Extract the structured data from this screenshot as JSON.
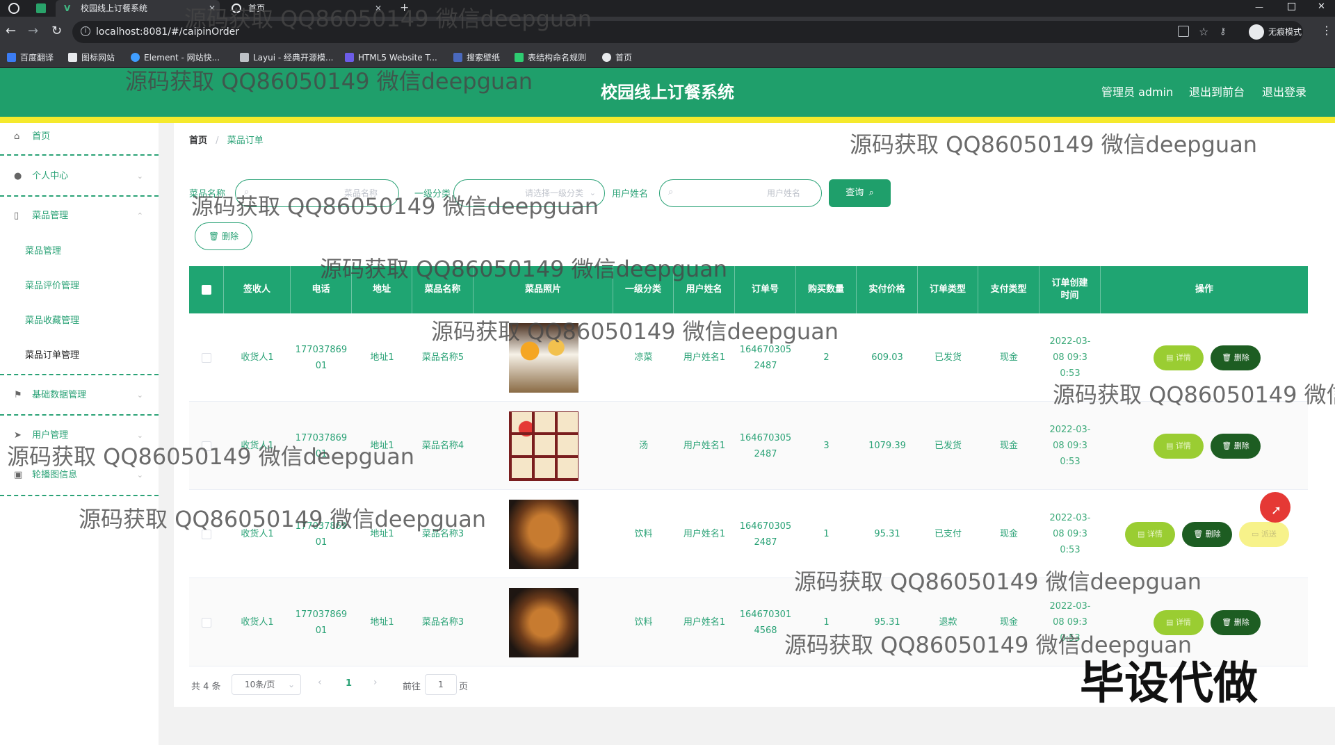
{
  "browser": {
    "tabs": [
      {
        "title": "校园线上订餐系统"
      },
      {
        "title": "首页"
      }
    ],
    "url": "localhost:8081/#/caipinOrder",
    "profile_label": "无痕模式",
    "bookmarks": [
      "百度翻译",
      "图标网站",
      "Element - 网站快...",
      "Layui - 经典开源模...",
      "HTML5 Website T...",
      "搜索壁纸",
      "表结构命名规则",
      "首页"
    ]
  },
  "header": {
    "title": "校园线上订餐系统",
    "admin_label": "管理员 admin",
    "back_frontend": "退出到前台",
    "logout": "退出登录"
  },
  "sidebar": {
    "home": "首页",
    "personal": "个人中心",
    "dish_mgmt": "菜品管理",
    "sub": [
      "菜品管理",
      "菜品评价管理",
      "菜品收藏管理",
      "菜品订单管理"
    ],
    "basic_data": "基础数据管理",
    "user_mgmt": "用户管理",
    "carousel": "轮播图信息"
  },
  "breadcrumb": {
    "home": "首页",
    "sep": "/",
    "current": "菜品订单"
  },
  "search": {
    "dish_label": "菜品名称",
    "dish_placeholder": "菜品名称",
    "cat_label": "一级分类",
    "cat_placeholder": "请选择一级分类",
    "user_label": "用户姓名",
    "user_placeholder": "用户姓名",
    "query_btn": "查询",
    "delete_btn": "删除"
  },
  "table": {
    "headers": [
      "签收人",
      "电话",
      "地址",
      "菜品名称",
      "菜品照片",
      "一级分类",
      "用户姓名",
      "订单号",
      "购买数量",
      "实付价格",
      "订单类型",
      "支付类型",
      "订单创建时间",
      "操作"
    ],
    "rows": [
      {
        "receiver": "收货人1",
        "phone": "17703786901",
        "addr": "地址1",
        "dish": "菜品名称5",
        "cat": "凉菜",
        "user": "用户姓名1",
        "order_no": "1646703052487",
        "qty": "2",
        "price": "609.03",
        "status": "已发货",
        "pay": "现金",
        "time": "2022-03-08 09:30:53"
      },
      {
        "receiver": "收货人1",
        "phone": "17703786901",
        "addr": "地址1",
        "dish": "菜品名称4",
        "cat": "汤",
        "user": "用户姓名1",
        "order_no": "1646703052487",
        "qty": "3",
        "price": "1079.39",
        "status": "已发货",
        "pay": "现金",
        "time": "2022-03-08 09:30:53"
      },
      {
        "receiver": "收货人1",
        "phone": "17703786901",
        "addr": "地址1",
        "dish": "菜品名称3",
        "cat": "饮料",
        "user": "用户姓名1",
        "order_no": "1646703052487",
        "qty": "1",
        "price": "95.31",
        "status": "已支付",
        "pay": "现金",
        "time": "2022-03-08 09:30:53"
      },
      {
        "receiver": "收货人1",
        "phone": "17703786901",
        "addr": "地址1",
        "dish": "菜品名称3",
        "cat": "饮料",
        "user": "用户姓名1",
        "order_no": "1646703014568",
        "qty": "1",
        "price": "95.31",
        "status": "退款",
        "pay": "现金",
        "time": "2022-03-08 09:30:53"
      }
    ],
    "actions": {
      "detail": "详情",
      "delete": "删除",
      "dispatch": "派送"
    }
  },
  "pagination": {
    "total": "共 4 条",
    "page_size": "10条/页",
    "current": "1",
    "goto_label": "前往",
    "goto_value": "1",
    "page_unit": "页"
  },
  "watermark": {
    "text": "源码获取 QQ86050149 微信deepguan",
    "text_cut": "源码获取 QQ86050149 微信d",
    "badge": "毕设代做"
  },
  "colors": {
    "primary": "#1f9f6b",
    "accent_yellow": "#f5e92c",
    "text_green": "#2aa276"
  }
}
